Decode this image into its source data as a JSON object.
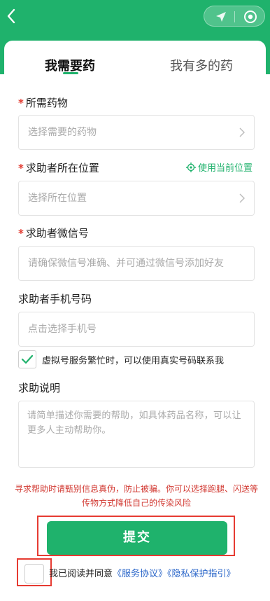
{
  "tabs": [
    {
      "label": "我需要药",
      "active": true
    },
    {
      "label": "我有多的药",
      "active": false
    }
  ],
  "form": {
    "medicine": {
      "label": "所需药物",
      "required_mark": "*",
      "placeholder": "选择需要的药物"
    },
    "location": {
      "label": "求助者所在位置",
      "required_mark": "*",
      "placeholder": "选择所在位置",
      "use_current": "使用当前位置"
    },
    "wechat": {
      "label": "求助者微信号",
      "required_mark": "*",
      "placeholder": "请确保微信号准确、并可通过微信号添加好友"
    },
    "phone": {
      "label": "求助者手机号码",
      "placeholder": "点击选择手机号"
    },
    "fallback_option": {
      "label": "虚拟号服务繁忙时，可以使用真实号码联系我",
      "checked": true
    },
    "description": {
      "label": "求助说明",
      "placeholder": "请简单描述你需要的帮助，如具体药品名称，可以让更多人主动帮助你。"
    }
  },
  "warning": "寻求帮助时请甄别信息真伪，防止被骗。你可以选择跑腿、闪送等传物方式降低自己的传染风险",
  "submit_label": "提交",
  "agreement": {
    "prefix": "我已阅读并同意",
    "service_link": "《服务协议》",
    "privacy_link": "《隐私保护指引》",
    "checked": false
  },
  "colors": {
    "brand": "#1fb26c",
    "alert": "#e63b32",
    "link": "#2a66c9"
  }
}
